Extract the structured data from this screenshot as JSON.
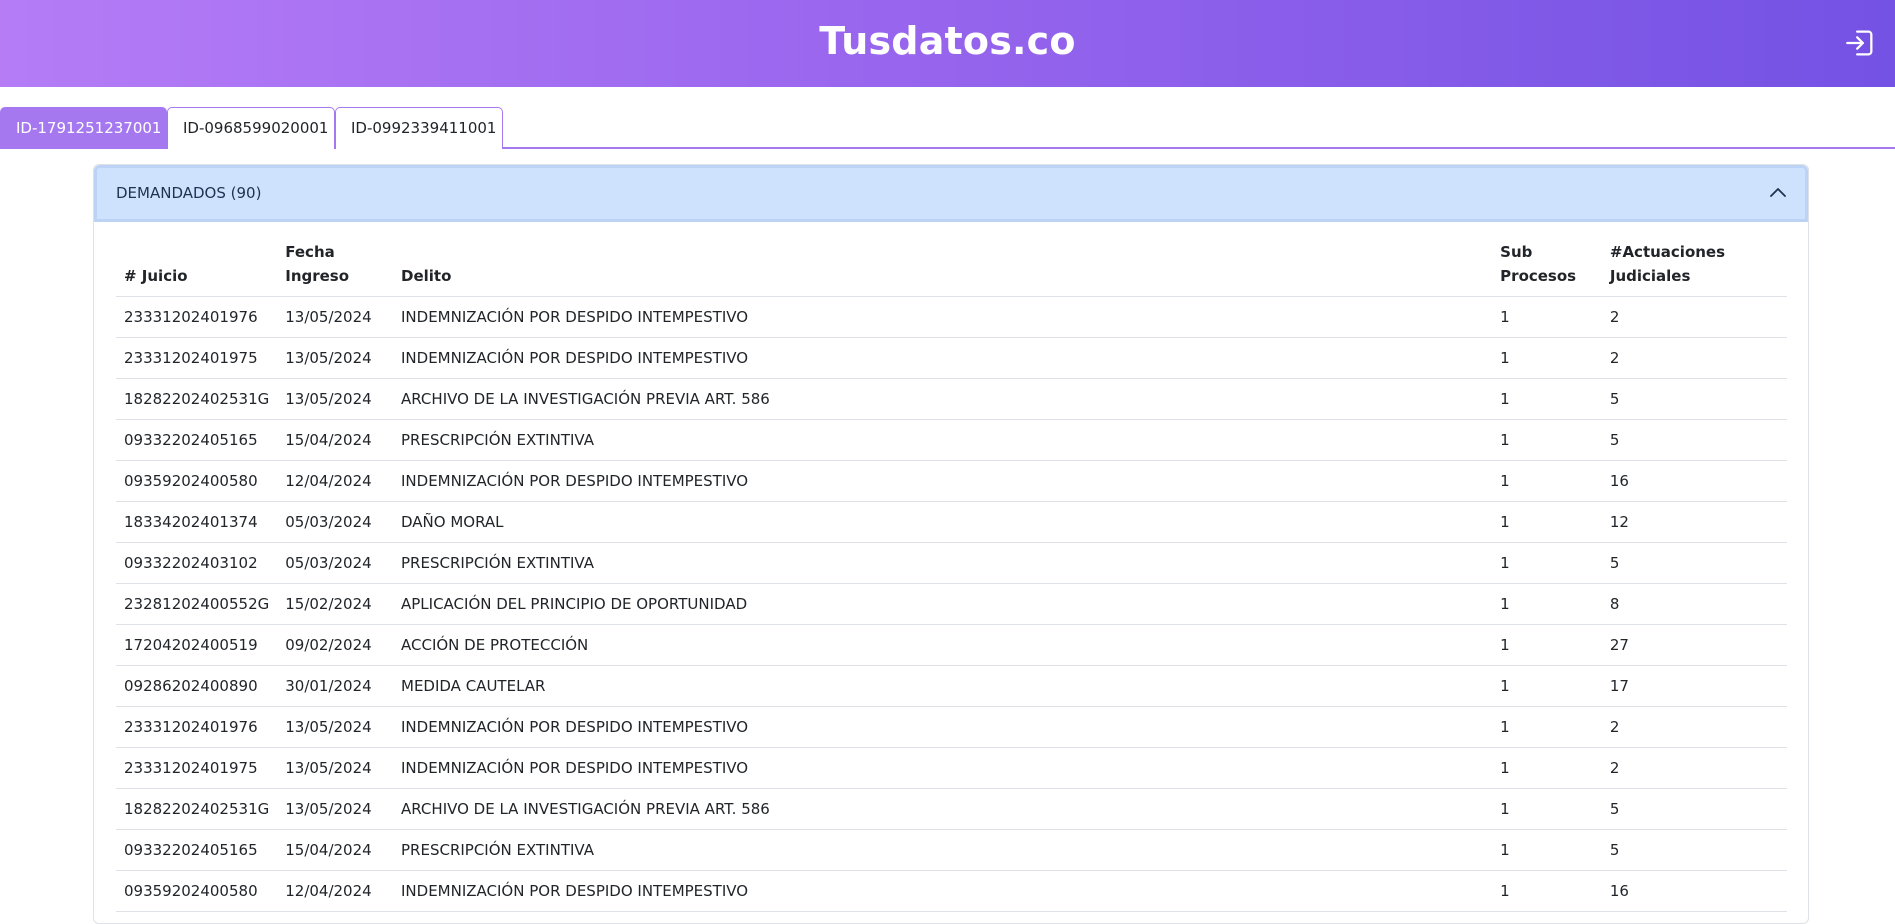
{
  "header": {
    "title": "Tusdatos.co",
    "logout_icon": "logout-icon"
  },
  "tabs": [
    {
      "label": "ID-1791251237001",
      "active": true
    },
    {
      "label": "ID-0968599020001",
      "active": false
    },
    {
      "label": "ID-0992339411001",
      "active": false
    }
  ],
  "accordion": {
    "title": "DEMANDADOS (90)",
    "toggle_icon": "chevron-up-icon",
    "expanded": true
  },
  "table": {
    "columns": [
      "# Juicio",
      "Fecha\nIngreso",
      "Delito",
      "Sub\nProcesos",
      "#Actuaciones\nJudiciales"
    ],
    "rows": [
      [
        "23331202401976",
        "13/05/2024",
        "INDEMNIZACIÓN POR DESPIDO INTEMPESTIVO",
        "1",
        "2"
      ],
      [
        "23331202401975",
        "13/05/2024",
        "INDEMNIZACIÓN POR DESPIDO INTEMPESTIVO",
        "1",
        "2"
      ],
      [
        "18282202402531G",
        "13/05/2024",
        "ARCHIVO DE LA INVESTIGACIÓN PREVIA ART. 586",
        "1",
        "5"
      ],
      [
        "09332202405165",
        "15/04/2024",
        "PRESCRIPCIÓN EXTINTIVA",
        "1",
        "5"
      ],
      [
        "09359202400580",
        "12/04/2024",
        "INDEMNIZACIÓN POR DESPIDO INTEMPESTIVO",
        "1",
        "16"
      ],
      [
        "18334202401374",
        "05/03/2024",
        "DAÑO MORAL",
        "1",
        "12"
      ],
      [
        "09332202403102",
        "05/03/2024",
        "PRESCRIPCIÓN EXTINTIVA",
        "1",
        "5"
      ],
      [
        "23281202400552G",
        "15/02/2024",
        "APLICACIÓN DEL PRINCIPIO DE OPORTUNIDAD",
        "1",
        "8"
      ],
      [
        "17204202400519",
        "09/02/2024",
        "ACCIÓN DE PROTECCIÓN",
        "1",
        "27"
      ],
      [
        "09286202400890",
        "30/01/2024",
        "MEDIDA CAUTELAR",
        "1",
        "17"
      ],
      [
        "23331202401976",
        "13/05/2024",
        "INDEMNIZACIÓN POR DESPIDO INTEMPESTIVO",
        "1",
        "2"
      ],
      [
        "23331202401975",
        "13/05/2024",
        "INDEMNIZACIÓN POR DESPIDO INTEMPESTIVO",
        "1",
        "2"
      ],
      [
        "18282202402531G",
        "13/05/2024",
        "ARCHIVO DE LA INVESTIGACIÓN PREVIA ART. 586",
        "1",
        "5"
      ],
      [
        "09332202405165",
        "15/04/2024",
        "PRESCRIPCIÓN EXTINTIVA",
        "1",
        "5"
      ],
      [
        "09359202400580",
        "12/04/2024",
        "INDEMNIZACIÓN POR DESPIDO INTEMPESTIVO",
        "1",
        "16"
      ]
    ]
  },
  "colors": {
    "header_gradient_start": "#b57cf6",
    "header_gradient_end": "#7452e4",
    "tab_accent": "#a678f0",
    "accordion_bg": "#cfe2fd"
  }
}
